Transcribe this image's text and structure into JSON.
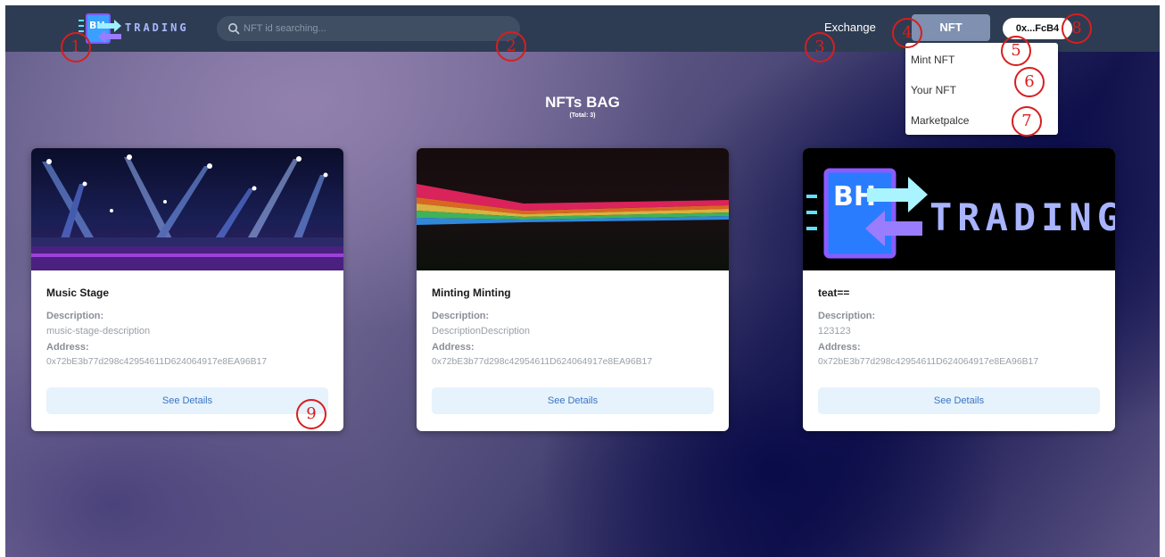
{
  "header": {
    "brand_text": "TRADING",
    "logo_icon": "bh-trading-logo-icon",
    "search": {
      "placeholder": "NFT id searching...",
      "value": ""
    },
    "nav": {
      "exchange": "Exchange",
      "nft": "NFT"
    },
    "wallet_label": "0x...FcB4"
  },
  "dropdown": {
    "items": [
      "Mint NFT",
      "Your NFT",
      "Marketpalce"
    ]
  },
  "page": {
    "title": "NFTs BAG",
    "subtitle": "(Total: 3)"
  },
  "cards": [
    {
      "title": "Music Stage",
      "description_label": "Description:",
      "description": "music-stage-description",
      "address_label": "Address:",
      "address": "0x72bE3b77d298c42954611D624064917e8EA96B17",
      "button": "See Details",
      "image": "concert-stage-lights"
    },
    {
      "title": "Minting Minting",
      "description_label": "Description:",
      "description": "DescriptionDescription",
      "address_label": "Address:",
      "address": "0x72bE3b77d298c42954611D624064917e8EA96B17",
      "button": "See Details",
      "image": "neon-light-streaks"
    },
    {
      "title": "teat==",
      "description_label": "Description:",
      "description": "123123",
      "address_label": "Address:",
      "address": "0x72bE3b77d298c42954611D624064917e8EA96B17",
      "button": "See Details",
      "image": "bh-trading-logo"
    }
  ],
  "annotations": [
    "1",
    "2",
    "3",
    "4",
    "5",
    "6",
    "7",
    "8",
    "9"
  ],
  "colors": {
    "topbar": "#2d3c52",
    "annotation": "#d81e1e",
    "button_bg": "#e6f2fc",
    "button_text": "#3a74c4",
    "nav_active": "#7f90b0"
  }
}
